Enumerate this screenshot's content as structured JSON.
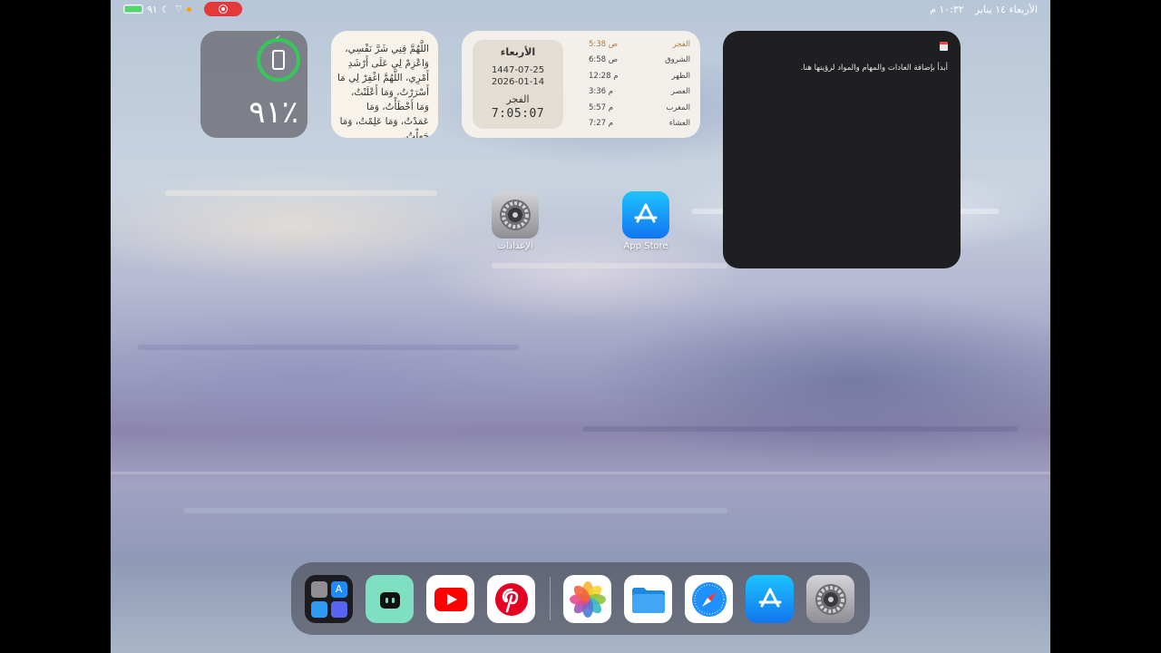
{
  "status_bar": {
    "battery_pct": "٩١",
    "time": "١٠:٣٢ م",
    "date": "الأربعاء ١٤ يناير",
    "recording": true
  },
  "battery_widget": {
    "percent_text": "٩١٪",
    "level": 0.91
  },
  "dua_widget": {
    "text": "اللَّهُمَّ قِنِي شَرَّ نَفْسِي، وَاعْزِمْ لِي عَلَى أَرْشَدِ أَمْرِي، اللَّهُمَّ اغْفِرْ لِي مَا أَسْرَرْتُ، وَمَا أَعْلَنْتُ، وَمَا أَخْطَأْتُ، وَمَا عَمَدْتُ، وَمَا عَلِمْتُ، وَمَا جَهِلْتُ."
  },
  "prayer_widget": {
    "day_name": "الأربعاء",
    "hijri_date": "1447-07-25",
    "gregorian_date": "2026-01-14",
    "next_prayer": "الفجر",
    "countdown": "7:05:07",
    "prayers": [
      {
        "name": "الفجر",
        "time": "5:38 ص",
        "active": true
      },
      {
        "name": "الشروق",
        "time": "6:58 ص",
        "active": false
      },
      {
        "name": "الظهر",
        "time": "12:28 م",
        "active": false
      },
      {
        "name": "العصر",
        "time": "3:36 م",
        "active": false
      },
      {
        "name": "المغرب",
        "time": "5:57 م",
        "active": false
      },
      {
        "name": "العشاء",
        "time": "7:27 م",
        "active": false
      }
    ]
  },
  "habits_widget": {
    "message": "أبدأ بإضافة العادات والمهام والمواد لرؤيتها هنا."
  },
  "apps": {
    "settings": {
      "label": "الإعدادات",
      "icon": "gear-icon"
    },
    "app_store": {
      "label": "App Store",
      "icon": "app-store-icon"
    }
  },
  "dock": {
    "apps": [
      "folder",
      "chatbot",
      "youtube",
      "pinterest",
      "photos",
      "files",
      "safari",
      "app-store",
      "settings"
    ]
  },
  "colors": {
    "battery_green": "#34c759",
    "recording_red": "#e5383b",
    "youtube_red": "#ff0000",
    "pinterest_red": "#e60023",
    "app_store_blue": "#1175f0"
  }
}
